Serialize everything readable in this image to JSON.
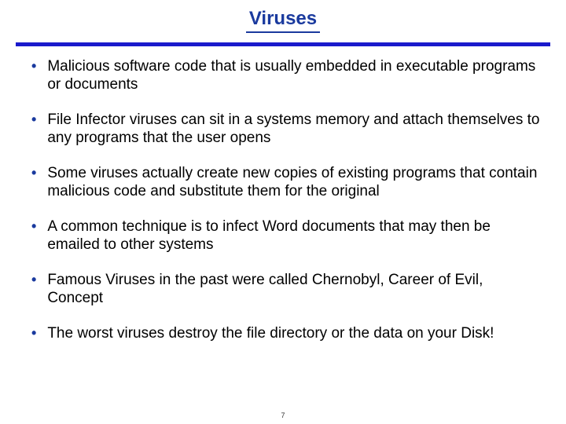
{
  "slide": {
    "title": "Viruses",
    "bullets": [
      "Malicious software code that is usually embedded in executable programs or documents",
      "File Infector viruses can sit in a systems memory and attach themselves to any programs that the user opens",
      "Some viruses actually create new copies of existing programs that contain malicious code and substitute them for the original",
      "A common technique is to infect Word documents that may then be emailed to other systems",
      "Famous Viruses in the past were called Chernobyl, Career of Evil, Concept",
      "The worst viruses destroy the file directory or the data on your Disk!"
    ],
    "page_number": "7"
  }
}
